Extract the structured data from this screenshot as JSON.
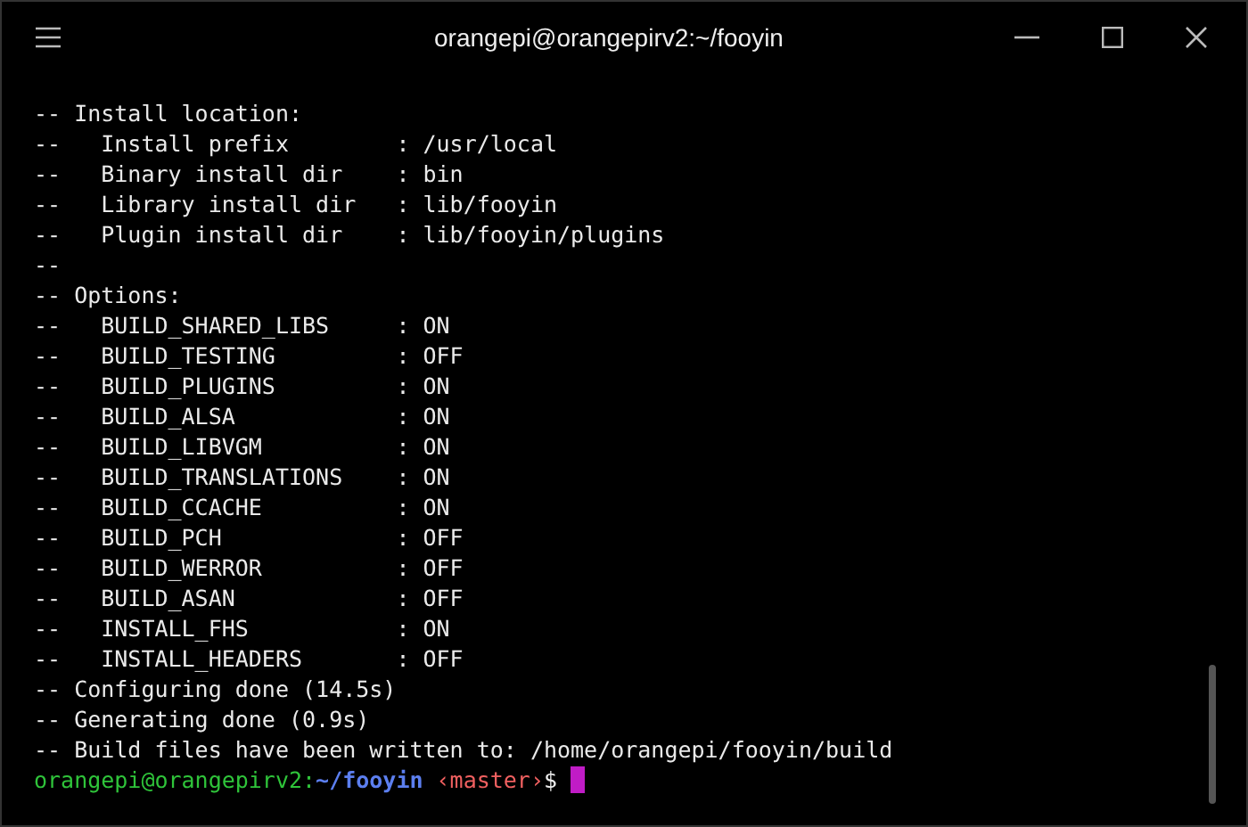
{
  "window": {
    "title": "orangepi@orangepirv2:~/fooyin"
  },
  "output": [
    "-- Install location:",
    "--   Install prefix        : /usr/local",
    "--   Binary install dir    : bin",
    "--   Library install dir   : lib/fooyin",
    "--   Plugin install dir    : lib/fooyin/plugins",
    "--",
    "-- Options:",
    "--   BUILD_SHARED_LIBS     : ON",
    "--   BUILD_TESTING         : OFF",
    "--   BUILD_PLUGINS         : ON",
    "--   BUILD_ALSA            : ON",
    "--   BUILD_LIBVGM          : ON",
    "--   BUILD_TRANSLATIONS    : ON",
    "--   BUILD_CCACHE          : ON",
    "--   BUILD_PCH             : OFF",
    "--   BUILD_WERROR          : OFF",
    "--   BUILD_ASAN            : OFF",
    "--   INSTALL_FHS           : ON",
    "--   INSTALL_HEADERS       : OFF",
    "-- Configuring done (14.5s)",
    "-- Generating done (0.9s)",
    "-- Build files have been written to: /home/orangepi/fooyin/build"
  ],
  "prompt": [
    {
      "kind": "user",
      "text": "orangepi@orangepirv2:"
    },
    {
      "kind": "path",
      "text": "~/fooyin"
    },
    {
      "kind": "branch",
      "text": "‹master›"
    },
    {
      "kind": "symbol",
      "text": "$"
    }
  ]
}
